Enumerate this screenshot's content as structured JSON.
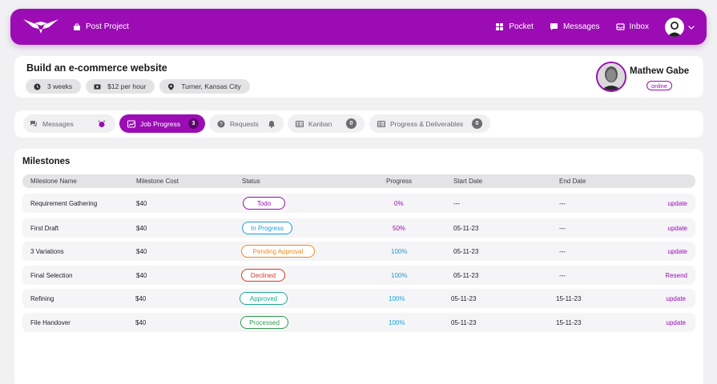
{
  "nav": {
    "post_project": "Post Project",
    "pocket": "Pocket",
    "messages": "Messages",
    "inbox": "Inbox",
    "accent": "#9b0cb4"
  },
  "project": {
    "title": "Build an e-commerce website",
    "duration": "3 weeks",
    "rate": "$12 per hour",
    "location": "Turner, Kansas City"
  },
  "user": {
    "name": "Mathew Gabe",
    "status": "online"
  },
  "tabs": [
    {
      "label": "Messages",
      "badge": ""
    },
    {
      "label": "Job Progress",
      "badge": "3"
    },
    {
      "label": "Requests",
      "badge": ""
    },
    {
      "label": "Kanban",
      "badge": "0"
    },
    {
      "label": "Progress & Deliverables",
      "badge": "0"
    }
  ],
  "milestones": {
    "title": "Milestones",
    "columns": [
      "Milestone Name",
      "Milestone Cost",
      "Status",
      "Progress",
      "Start Date",
      "End Date"
    ],
    "rows": [
      {
        "name": "Requirement Gathering",
        "cost": "$40",
        "status": "Todo",
        "progress": "0%",
        "start": "---",
        "end": "---",
        "action": "update"
      },
      {
        "name": "First Draft",
        "cost": "$40",
        "status": "In Progress",
        "progress": "50%",
        "start": "05-11-23",
        "end": "---",
        "action": "update"
      },
      {
        "name": "3 Variations",
        "cost": "$40",
        "status": "Pending Approval",
        "progress": "100%",
        "start": "05-11-23",
        "end": "---",
        "action": "update"
      },
      {
        "name": "Final Selection",
        "cost": "$40",
        "status": "Declined",
        "progress": "100%",
        "start": "05-11-23",
        "end": "---",
        "action": "Resend"
      },
      {
        "name": "Refining",
        "cost": "$40",
        "status": "Approved",
        "progress": "100%",
        "start": "05-11-23",
        "end": "15-11-23",
        "action": "update"
      },
      {
        "name": "File Handover",
        "cost": "$40",
        "status": "Processed",
        "progress": "100%",
        "start": "05-11-23",
        "end": "15-11-23",
        "action": "update"
      }
    ]
  },
  "status_colors": {
    "Todo": "#9b0cb4",
    "In Progress": "#1aa0d8",
    "Pending Approval": "#f08a1c",
    "Declined": "#d9342b",
    "Approved": "#1fa88e",
    "Processed": "#2e9b4a"
  },
  "progress_colors": {
    "0%": "#9b0cb4",
    "50%": "#9b0cb4",
    "100%": "#1aa0d8"
  }
}
